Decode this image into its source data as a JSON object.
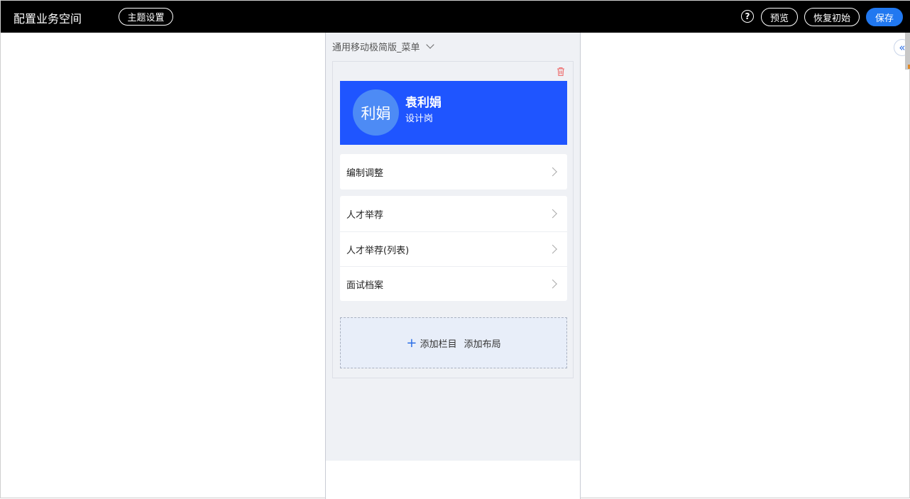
{
  "header": {
    "title": "配置业务空间",
    "theme_btn": "主题设置",
    "help_glyph": "?",
    "preview_btn": "预览",
    "reset_btn": "恢复初始",
    "save_btn": "保存"
  },
  "canvas": {
    "menu_select": "通用移动极简版_菜单",
    "profile": {
      "avatar_text": "利娟",
      "name": "袁利娟",
      "role": "设计岗"
    },
    "groups": [
      {
        "items": [
          {
            "label": "编制调整"
          }
        ]
      },
      {
        "items": [
          {
            "label": "人才举荐"
          },
          {
            "label": "人才举荐(列表)"
          },
          {
            "label": "面试档案"
          }
        ]
      }
    ],
    "add_column": "添加栏目",
    "add_layout": "添加布局"
  },
  "side": {
    "collapse_glyph": "«"
  },
  "colors": {
    "topbar_bg": "#000000",
    "accent": "#2178f0",
    "profile_bg": "#1f55ff",
    "avatar_bg": "#4d8bf5",
    "trash": "#ee6b6b"
  }
}
